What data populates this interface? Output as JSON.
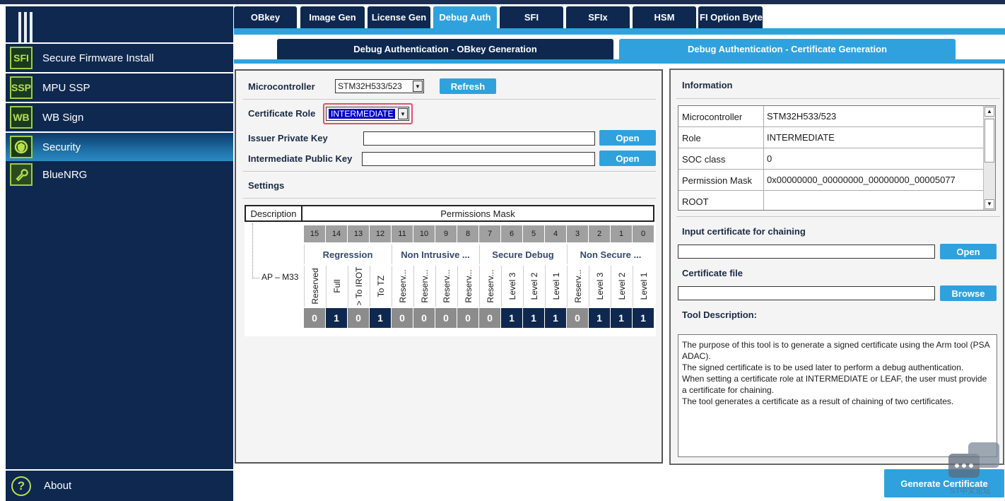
{
  "sidebar": {
    "items": [
      {
        "badge": "SFI",
        "label": "Secure Firmware Install"
      },
      {
        "badge": "SSP",
        "label": "MPU SSP"
      },
      {
        "badge": "WB",
        "label": "WB Sign"
      },
      {
        "badge": "",
        "label": "Security",
        "icon": "shield-gear-icon"
      },
      {
        "badge": "",
        "label": "BlueNRG",
        "icon": "wrench-icon"
      }
    ],
    "about": {
      "icon": "question-icon",
      "label": "About"
    }
  },
  "tabs": [
    "OBkey",
    "Image Gen",
    "License Gen",
    "Debug Auth",
    "SFI",
    "SFIx",
    "HSM",
    "FI Option Byte"
  ],
  "subtabs": [
    "Debug Authentication - OBkey Generation",
    "Debug Authentication - Certificate Generation"
  ],
  "left": {
    "microcontroller_label": "Microcontroller",
    "microcontroller_value": "STM32H533/523",
    "refresh_label": "Refresh",
    "cert_role_label": "Certificate Role",
    "cert_role_value": "INTERMEDIATE",
    "issuer_key_label": "Issuer Private Key",
    "intermediate_key_label": "Intermediate Public Key",
    "open_label": "Open",
    "settings_label": "Settings",
    "perm": {
      "desc_header": "Description",
      "mask_header": "Permissions Mask",
      "row_label": "AP – M33",
      "bits": [
        "15",
        "14",
        "13",
        "12",
        "11",
        "10",
        "9",
        "8",
        "7",
        "6",
        "5",
        "4",
        "3",
        "2",
        "1",
        "0"
      ],
      "groups": [
        "Regression",
        "Non Intrusive ...",
        "Secure Debug",
        "Non Secure ..."
      ],
      "labels": [
        "Reserved",
        "Full",
        "> To IROT",
        "To TZ",
        "Reserv...",
        "Reserv...",
        "Reserv...",
        "Reserv...",
        "Reserv...",
        "Level 3",
        "Level 2",
        "Level 1",
        "Reserv...",
        "Level 3",
        "Level 2",
        "Level 1"
      ],
      "values": [
        "0",
        "1",
        "0",
        "1",
        "0",
        "0",
        "0",
        "0",
        "0",
        "1",
        "1",
        "1",
        "0",
        "1",
        "1",
        "1"
      ]
    }
  },
  "right": {
    "info_label": "Information",
    "info_rows": [
      {
        "k": "Microcontroller",
        "v": "STM32H533/523"
      },
      {
        "k": "Role",
        "v": "INTERMEDIATE"
      },
      {
        "k": "SOC class",
        "v": "0"
      },
      {
        "k": "Permission Mask",
        "v": "0x00000000_00000000_00000000_00005077"
      },
      {
        "k": "ROOT",
        "v": ""
      }
    ],
    "input_cert_label": "Input certificate for chaining",
    "open_label": "Open",
    "cert_file_label": "Certificate file",
    "browse_label": "Browse",
    "tool_desc_label": "Tool Description:",
    "tool_desc_lines": [
      "The purpose of this tool is to generate a signed certificate using the Arm tool (PSA ADAC).",
      "The signed certificate is to be used later to perform a debug authentication.",
      "When setting a certificate role at INTERMEDIATE or LEAF, the user must provide a certificate for chaining.",
      "The tool generates a certificate as a result of chaining of two certificates."
    ]
  },
  "generate_label": "Generate Certificate",
  "watermark_text": "ST中文论坛",
  "colors": {
    "navy": "#0e2850",
    "accent": "#2fa2de",
    "green": "#9fcf3b",
    "highlight": "#e3506a"
  }
}
